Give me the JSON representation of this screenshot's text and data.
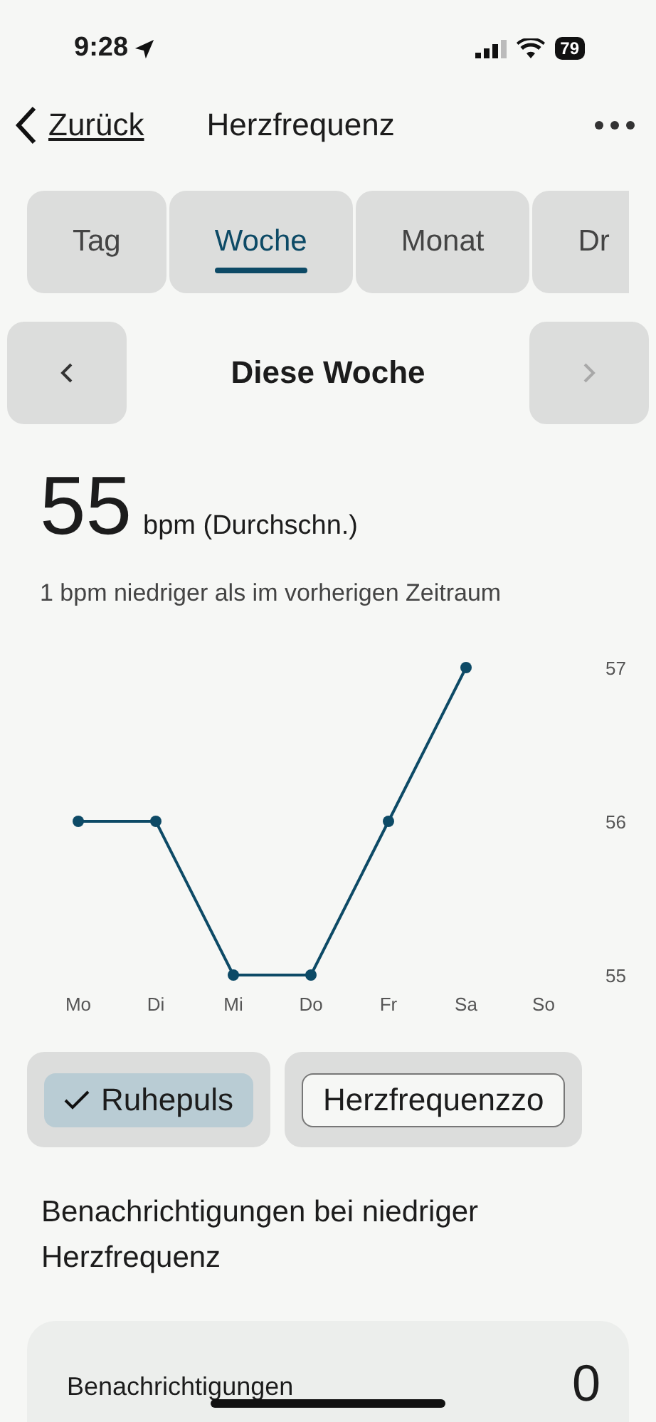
{
  "status_bar": {
    "time": "9:28",
    "battery": "79"
  },
  "header": {
    "back": "Zurück",
    "title": "Herzfrequenz"
  },
  "tabs": [
    {
      "label": "Tag",
      "selected": false
    },
    {
      "label": "Woche",
      "selected": true
    },
    {
      "label": "Monat",
      "selected": false
    },
    {
      "label": "Dr",
      "selected": false
    }
  ],
  "period": {
    "label": "Diese Woche",
    "next_disabled": true
  },
  "summary": {
    "value": "55",
    "unit": "bpm (Durchschn.)",
    "comparison": "1 bpm niedriger als im vorherigen Zeitraum"
  },
  "chart_data": {
    "type": "line",
    "categories": [
      "Mo",
      "Di",
      "Mi",
      "Do",
      "Fr",
      "Sa",
      "So"
    ],
    "series": [
      {
        "color": "#0d4a66",
        "marker": true,
        "values": [
          56,
          56,
          55,
          55,
          56,
          57,
          null
        ]
      }
    ],
    "ylim": [
      55,
      57
    ],
    "yticks": [
      55,
      56,
      57
    ]
  },
  "chips": [
    {
      "label": "Ruhepuls",
      "selected": true
    },
    {
      "label": "Herzfrequenzzo",
      "selected": false
    }
  ],
  "section": {
    "title": "Benachrichtigungen bei niedriger Herzfrequenz"
  },
  "card": {
    "label": "Benachrichtigungen",
    "value": "0"
  }
}
